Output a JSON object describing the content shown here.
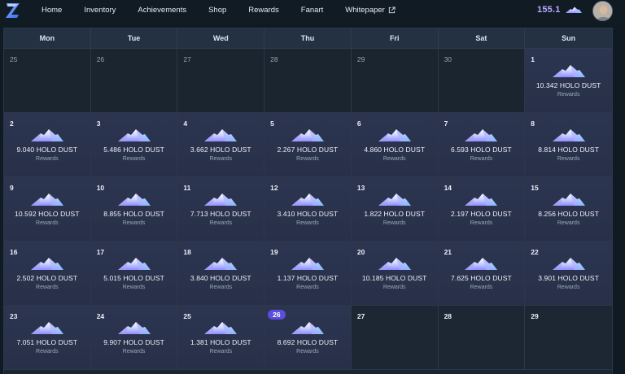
{
  "nav": {
    "items": [
      "Home",
      "Inventory",
      "Achievements",
      "Shop",
      "Rewards",
      "Fanart",
      "Whitepaper"
    ]
  },
  "balance": {
    "value": "155.1",
    "icon": "holo-dust-icon"
  },
  "avatar": {
    "icon": "user-avatar"
  },
  "colors": {
    "accent": "#5b4de0",
    "balance": "#b9a9ff",
    "background": "#0f1a22"
  },
  "calendar": {
    "weekdays": [
      "Mon",
      "Tue",
      "Wed",
      "Thu",
      "Fri",
      "Sat",
      "Sun"
    ],
    "today": "26",
    "days": [
      {
        "day": "25",
        "outside": true
      },
      {
        "day": "26",
        "outside": true
      },
      {
        "day": "27",
        "outside": true
      },
      {
        "day": "28",
        "outside": true
      },
      {
        "day": "29",
        "outside": true
      },
      {
        "day": "30",
        "outside": true
      },
      {
        "day": "1",
        "amount": "10.342 HOLO DUST",
        "label": "Rewards"
      },
      {
        "day": "2",
        "amount": "9.040 HOLO DUST",
        "label": "Rewards"
      },
      {
        "day": "3",
        "amount": "5.486 HOLO DUST",
        "label": "Rewards"
      },
      {
        "day": "4",
        "amount": "3.662 HOLO DUST",
        "label": "Rewards"
      },
      {
        "day": "5",
        "amount": "2.267 HOLO DUST",
        "label": "Rewards"
      },
      {
        "day": "6",
        "amount": "4.860 HOLO DUST",
        "label": "Rewards"
      },
      {
        "day": "7",
        "amount": "6.593 HOLO DUST",
        "label": "Rewards"
      },
      {
        "day": "8",
        "amount": "8.814 HOLO DUST",
        "label": "Rewards"
      },
      {
        "day": "9",
        "amount": "10.592 HOLO DUST",
        "label": "Rewards"
      },
      {
        "day": "10",
        "amount": "8.855 HOLO DUST",
        "label": "Rewards"
      },
      {
        "day": "11",
        "amount": "7.713 HOLO DUST",
        "label": "Rewards"
      },
      {
        "day": "12",
        "amount": "3.410 HOLO DUST",
        "label": "Rewards"
      },
      {
        "day": "13",
        "amount": "1.822 HOLO DUST",
        "label": "Rewards"
      },
      {
        "day": "14",
        "amount": "2.197 HOLO DUST",
        "label": "Rewards"
      },
      {
        "day": "15",
        "amount": "8.256 HOLO DUST",
        "label": "Rewards"
      },
      {
        "day": "16",
        "amount": "2.502 HOLO DUST",
        "label": "Rewards"
      },
      {
        "day": "17",
        "amount": "5.015 HOLO DUST",
        "label": "Rewards"
      },
      {
        "day": "18",
        "amount": "3.840 HOLO DUST",
        "label": "Rewards"
      },
      {
        "day": "19",
        "amount": "1.137 HOLO DUST",
        "label": "Rewards"
      },
      {
        "day": "20",
        "amount": "10.185 HOLO DUST",
        "label": "Rewards"
      },
      {
        "day": "21",
        "amount": "7.625 HOLO DUST",
        "label": "Rewards"
      },
      {
        "day": "22",
        "amount": "3.901 HOLO DUST",
        "label": "Rewards"
      },
      {
        "day": "23",
        "amount": "7.051 HOLO DUST",
        "label": "Rewards"
      },
      {
        "day": "24",
        "amount": "9.907 HOLO DUST",
        "label": "Rewards"
      },
      {
        "day": "25",
        "amount": "1.381 HOLO DUST",
        "label": "Rewards"
      },
      {
        "day": "26",
        "amount": "8.692 HOLO DUST",
        "label": "Rewards"
      },
      {
        "day": "27",
        "empty": true
      },
      {
        "day": "28",
        "empty": true
      },
      {
        "day": "29",
        "empty": true
      }
    ]
  }
}
